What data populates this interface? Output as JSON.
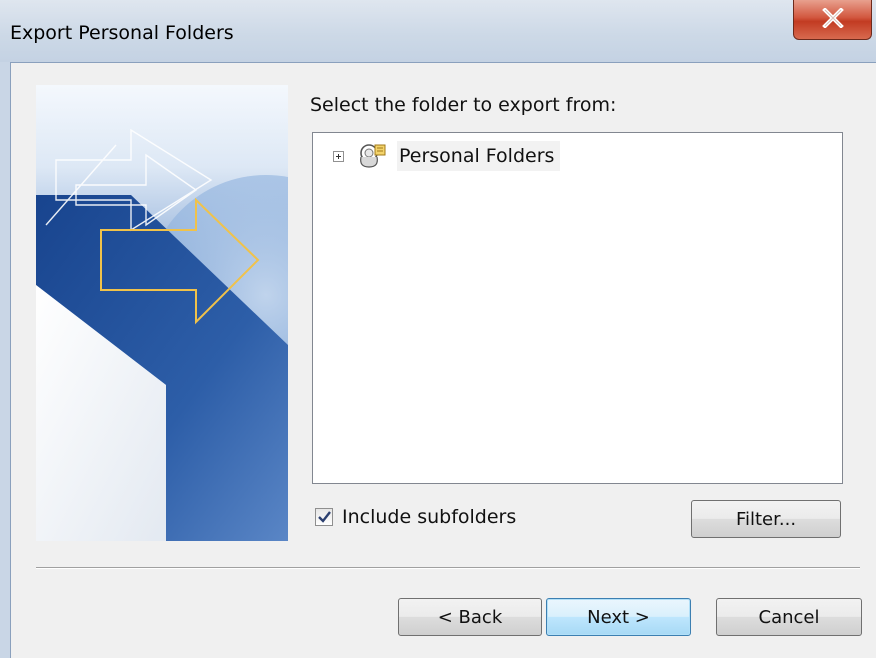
{
  "window": {
    "title": "Export Personal Folders",
    "close_icon": "close-icon"
  },
  "wizard": {
    "prompt": "Select the folder to export from:",
    "tree": {
      "items": [
        {
          "label": "Personal Folders",
          "expander": "plus",
          "icon": "personal-folders-icon"
        }
      ]
    },
    "include_subfolders": {
      "label": "Include subfolders",
      "checked": true
    },
    "filter_button": "Filter...",
    "back_button": "< Back",
    "next_button": "Next >",
    "cancel_button": "Cancel"
  },
  "colors": {
    "accent": "#3c7fb1",
    "close_red": "#c23b22",
    "art_blue": "#1f4f9a"
  }
}
